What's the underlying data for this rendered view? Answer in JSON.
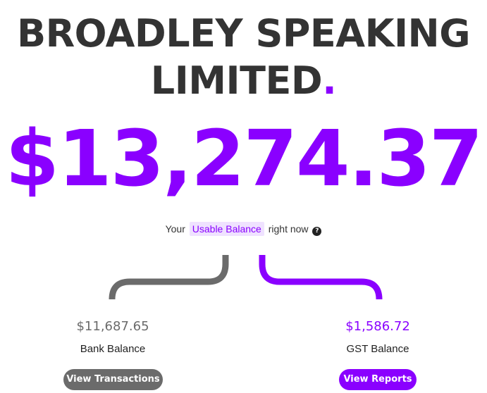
{
  "header": {
    "company_line1": "BROADLEY SPEAKING",
    "company_line2": "LIMITED",
    "company_dot": "."
  },
  "balance": {
    "amount": "$13,274.37",
    "prefix": "Your",
    "highlight": "Usable Balance",
    "suffix": "right now",
    "help_icon": "?"
  },
  "bank": {
    "amount": "$11,687.65",
    "label": "Bank Balance",
    "button_label": "View Transactions"
  },
  "gst": {
    "amount": "$1,586.72",
    "label": "GST Balance",
    "button_label": "View Reports"
  },
  "colors": {
    "accent": "#8a00ff",
    "neutral": "#6b6b6b",
    "heading": "#333333",
    "highlight_bg": "#efe2ff"
  }
}
